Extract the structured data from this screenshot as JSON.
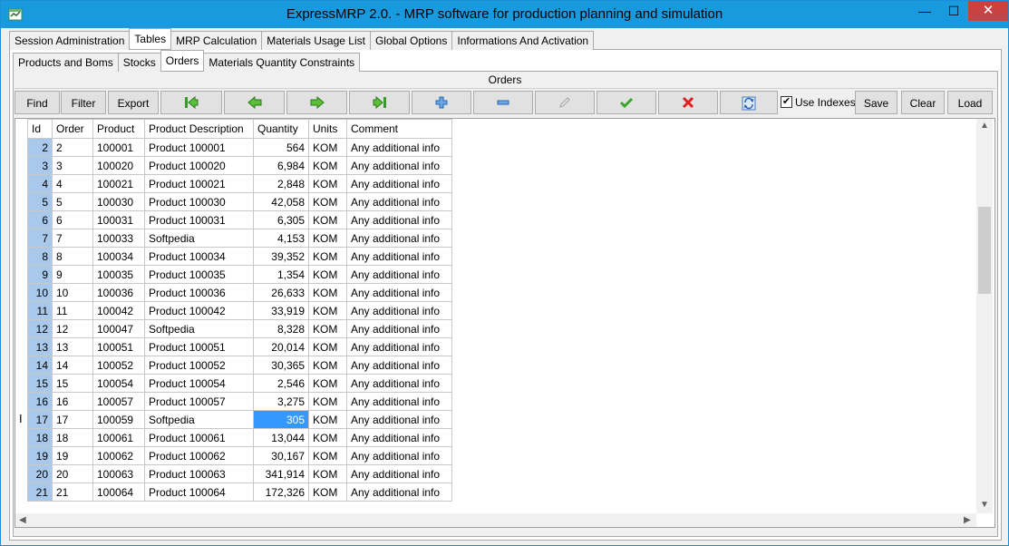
{
  "window": {
    "title": "ExpressMRP 2.0. - MRP software for production planning and simulation",
    "minimize": "—",
    "maximize": "☐",
    "close": "✕"
  },
  "main_tabs": [
    "Session Administration",
    "Tables",
    "MRP Calculation",
    "Materials Usage List",
    "Global Options",
    "Informations And Activation"
  ],
  "sub_tabs": [
    "Products and Boms",
    "Stocks",
    "Orders",
    "Materials Quantity Constraints"
  ],
  "section_title": "Orders",
  "toolbar": {
    "find": "Find",
    "filter": "Filter",
    "export": "Export",
    "use_indexes_label": "Use Indexes",
    "use_indexes_checked": "✔",
    "save": "Save",
    "clear": "Clear",
    "load": "Load"
  },
  "columns": [
    "Id",
    "Order",
    "Product",
    "Product Description",
    "Quantity",
    "Units",
    "Comment"
  ],
  "rows": [
    [
      "2",
      "2",
      "100001",
      "Product 100001",
      "564",
      "KOM",
      "Any additional info"
    ],
    [
      "3",
      "3",
      "100020",
      "Product 100020",
      "6,984",
      "KOM",
      "Any additional info"
    ],
    [
      "4",
      "4",
      "100021",
      "Product 100021",
      "2,848",
      "KOM",
      "Any additional info"
    ],
    [
      "5",
      "5",
      "100030",
      "Product 100030",
      "42,058",
      "KOM",
      "Any additional info"
    ],
    [
      "6",
      "6",
      "100031",
      "Product 100031",
      "6,305",
      "KOM",
      "Any additional info"
    ],
    [
      "7",
      "7",
      "100033",
      "Softpedia",
      "4,153",
      "KOM",
      "Any additional info"
    ],
    [
      "8",
      "8",
      "100034",
      "Product 100034",
      "39,352",
      "KOM",
      "Any additional info"
    ],
    [
      "9",
      "9",
      "100035",
      "Product 100035",
      "1,354",
      "KOM",
      "Any additional info"
    ],
    [
      "10",
      "10",
      "100036",
      "Product 100036",
      "26,633",
      "KOM",
      "Any additional info"
    ],
    [
      "11",
      "11",
      "100042",
      "Product 100042",
      "33,919",
      "KOM",
      "Any additional info"
    ],
    [
      "12",
      "12",
      "100047",
      "Softpedia",
      "8,328",
      "KOM",
      "Any additional info"
    ],
    [
      "13",
      "13",
      "100051",
      "Product 100051",
      "20,014",
      "KOM",
      "Any additional info"
    ],
    [
      "14",
      "14",
      "100052",
      "Product 100052",
      "30,365",
      "KOM",
      "Any additional info"
    ],
    [
      "15",
      "15",
      "100054",
      "Product 100054",
      "2,546",
      "KOM",
      "Any additional info"
    ],
    [
      "16",
      "16",
      "100057",
      "Product 100057",
      "3,275",
      "KOM",
      "Any additional info"
    ],
    [
      "17",
      "17",
      "100059",
      "Softpedia",
      "305",
      "KOM",
      "Any additional info"
    ],
    [
      "18",
      "18",
      "100061",
      "Product 100061",
      "13,044",
      "KOM",
      "Any additional info"
    ],
    [
      "19",
      "19",
      "100062",
      "Product 100062",
      "30,167",
      "KOM",
      "Any additional info"
    ],
    [
      "20",
      "20",
      "100063",
      "Product 100063",
      "341,914",
      "KOM",
      "Any additional info"
    ],
    [
      "21",
      "21",
      "100064",
      "Product 100064",
      "172,326",
      "KOM",
      "Any additional info"
    ]
  ],
  "selected_row_index": 15,
  "current_row_marker": "I",
  "colors": {
    "titlebar": "#1a9ade",
    "selection": "#3399ff",
    "id_column": "#a8c8ec",
    "close_button": "#c74343"
  }
}
